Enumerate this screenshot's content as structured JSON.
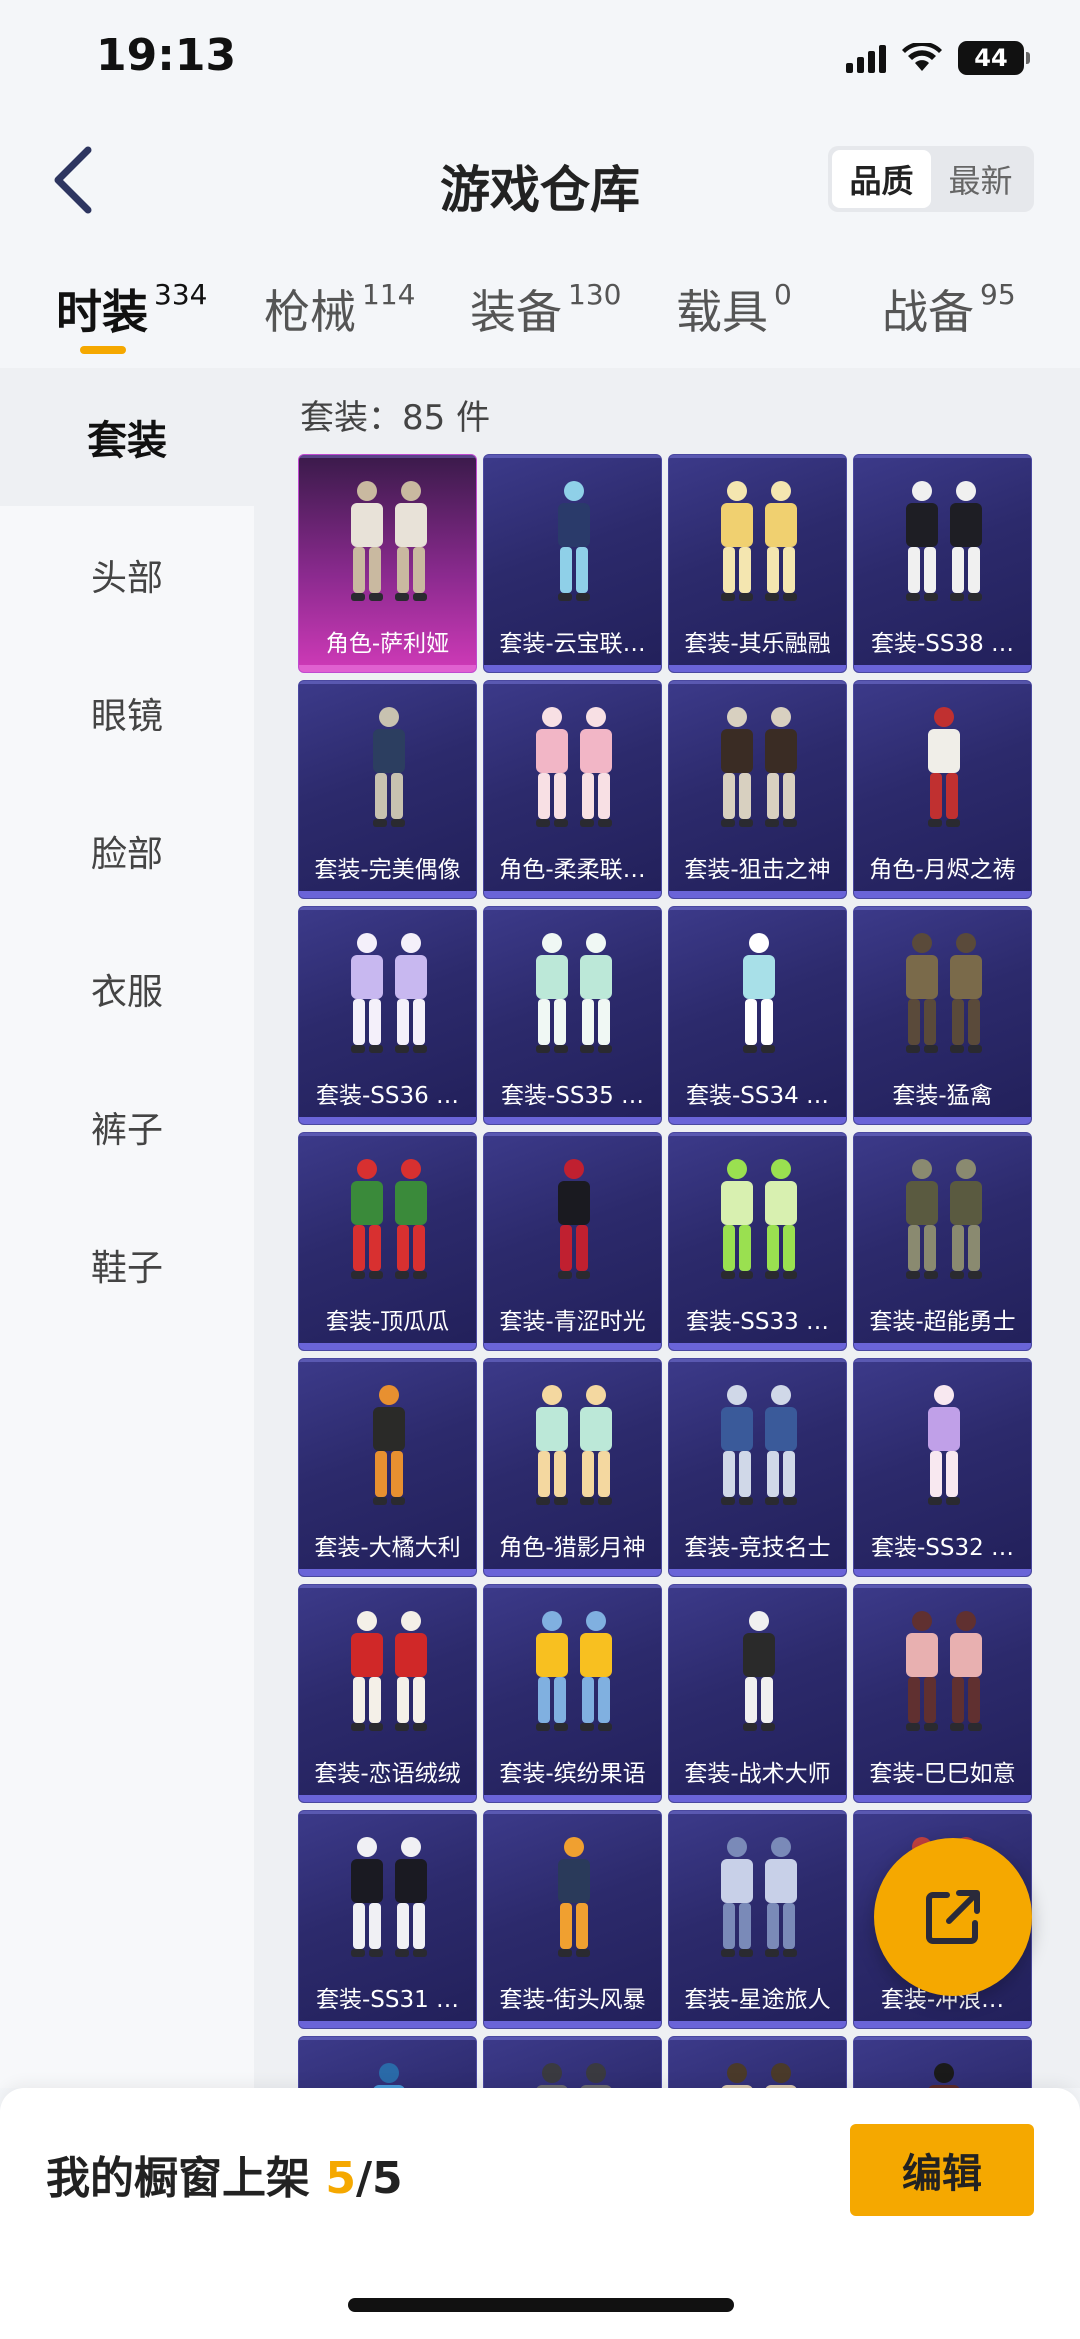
{
  "status_bar": {
    "time": "19:13",
    "battery": "44",
    "icons": [
      "signal-icon",
      "wifi-icon",
      "battery-icon"
    ]
  },
  "header": {
    "title": "游戏仓库",
    "back_icon": "chevron-left-icon",
    "sort": [
      "品质",
      "最新"
    ],
    "sort_active": 0
  },
  "tabs": [
    {
      "label": "时装",
      "count": "334"
    },
    {
      "label": "枪械",
      "count": "114"
    },
    {
      "label": "装备",
      "count": "130"
    },
    {
      "label": "载具",
      "count": "0"
    },
    {
      "label": "战备",
      "count": "95"
    }
  ],
  "sidebar": [
    "套装",
    "头部",
    "眼镜",
    "脸部",
    "衣服",
    "裤子",
    "鞋子"
  ],
  "section": {
    "count_text": "套装：85 件"
  },
  "items": [
    "角色-萨利娅",
    "套装-云宝联…",
    "套装-其乐融融",
    "套装-SS38 …",
    "套装-完美偶像",
    "角色-柔柔联…",
    "套装-狙击之神",
    "角色-月烬之祷",
    "套装-SS36 …",
    "套装-SS35 …",
    "套装-SS34 …",
    "套装-猛禽",
    "套装-顶瓜瓜",
    "套装-青涩时光",
    "套装-SS33 …",
    "套装-超能勇士",
    "套装-大橘大利",
    "角色-猎影月神",
    "套装-竞技名士",
    "套装-SS32 …",
    "套装-恋语绒绒",
    "套装-缤纷果语",
    "套装-战术大师",
    "套装-巳巳如意",
    "套装-SS31 …",
    "套装-街头风暴",
    "套装-星途旅人",
    "套装-冲浪…",
    "",
    "",
    "",
    ""
  ],
  "bottom": {
    "label": "我的橱窗上架 ",
    "current": "5",
    "total": "/5",
    "edit": "编辑"
  },
  "colors": {
    "accent": "#f5a800",
    "card": "#2c2a6c",
    "rare": "#c04ad0"
  },
  "fab_icon": "share-icon"
}
